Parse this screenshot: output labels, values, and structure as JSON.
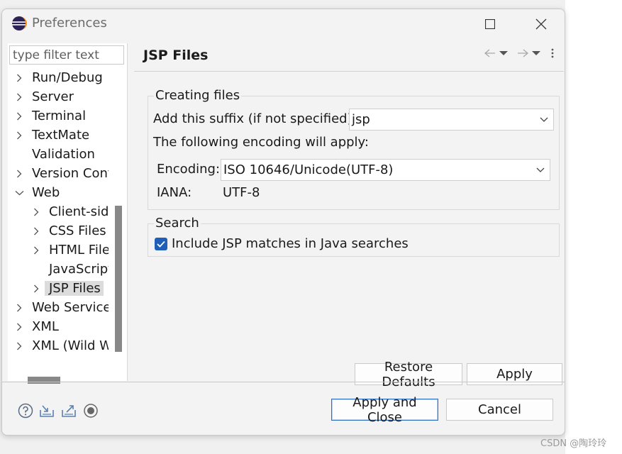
{
  "window": {
    "title": "Preferences"
  },
  "filter": {
    "placeholder": "type filter text"
  },
  "tree": {
    "items": [
      {
        "label": "Run/Debug",
        "expanded": false
      },
      {
        "label": "Server",
        "expanded": false
      },
      {
        "label": "Terminal",
        "expanded": false
      },
      {
        "label": "TextMate",
        "expanded": false
      },
      {
        "label": "Validation"
      },
      {
        "label": "Version Cont",
        "expanded": false
      },
      {
        "label": "Web",
        "expanded": true
      },
      {
        "label": "Client-side",
        "expanded": false
      },
      {
        "label": "CSS Files",
        "expanded": false
      },
      {
        "label": "HTML File",
        "expanded": false
      },
      {
        "label": "JavaScript"
      },
      {
        "label": "JSP Files",
        "expanded": false,
        "selected": true
      },
      {
        "label": "Web Services",
        "expanded": false
      },
      {
        "label": "XML",
        "expanded": false
      },
      {
        "label": "XML (Wild W",
        "expanded": false
      }
    ]
  },
  "page": {
    "title": "JSP Files",
    "creating_files": {
      "group_label": "Creating files",
      "suffix_label": "Add this suffix (if not specified):",
      "suffix_value": "jsp",
      "encoding_note": "The following encoding will apply:",
      "encoding_label": "Encoding:",
      "encoding_value": "ISO 10646/Unicode(UTF-8)",
      "iana_label": "IANA:",
      "iana_value": "UTF-8"
    },
    "search": {
      "group_label": "Search",
      "checkbox_label": "Include JSP matches in Java searches",
      "checked": true
    },
    "restore_defaults": "Restore Defaults",
    "apply": "Apply"
  },
  "footer": {
    "apply_and_close": "Apply and Close",
    "cancel": "Cancel"
  },
  "watermark": "CSDN @陶玲玲",
  "colors": {
    "accent": "#1f5fb8",
    "selection": "#dcdcdc"
  },
  "icons": [
    "eclipse-icon",
    "maximize-icon",
    "close-icon",
    "back-arrow-icon",
    "forward-arrow-icon",
    "view-menu-icon",
    "help-icon",
    "import-icon",
    "export-icon",
    "record-icon"
  ]
}
